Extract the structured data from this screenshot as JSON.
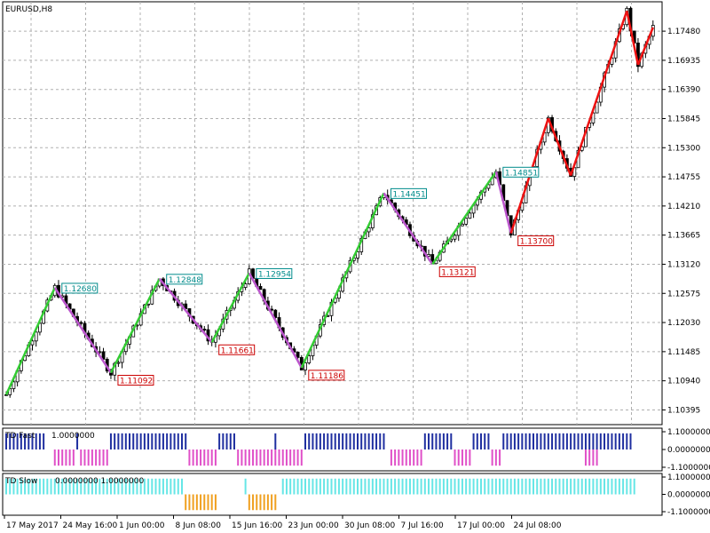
{
  "window_title": "EURUSD,H8",
  "colors": {
    "up_zigzag": "#33cc33",
    "down_zigzag": "#bb55cc",
    "recent_zigzag": "#ee1111",
    "high_label": "#008b8b",
    "low_label": "#cc0000",
    "fast_blue": "#1f2fa0",
    "fast_magenta": "#e050c8",
    "slow_cyan": "#66e6e6",
    "slow_orange": "#f0a020",
    "grid": "#b0b0b0"
  },
  "chart_data": [
    {
      "type": "candlestick",
      "title": "EURUSD,H8",
      "ylim": [
        1.1012,
        1.1803
      ],
      "y_ticks": [
        "1.17480",
        "1.16935",
        "1.16390",
        "1.15845",
        "1.15300",
        "1.14755",
        "1.14210",
        "1.13665",
        "1.13120",
        "1.12575",
        "1.12030",
        "1.11485",
        "1.10940",
        "1.10395"
      ],
      "x_ticks": [
        "17 May 2017",
        "24 May 16:00",
        "1 Jun 00:00",
        "8 Jun 08:00",
        "15 Jun 16:00",
        "23 Jun 00:00",
        "30 Jun 08:00",
        "7 Jul 16:00",
        "17 Jul 00:00",
        "24 Jul 08:00"
      ],
      "grid": true,
      "zigzag": [
        {
          "bar": 0,
          "price": 1.1068
        },
        {
          "bar": 13,
          "price": 1.1268,
          "label": "1.12680",
          "kind": "high"
        },
        {
          "bar": 28,
          "price": 1.11092,
          "label": "1.11092",
          "kind": "low"
        },
        {
          "bar": 41,
          "price": 1.12848,
          "label": "1.12848",
          "kind": "high"
        },
        {
          "bar": 55,
          "price": 1.11661,
          "label": "1.11661",
          "kind": "low"
        },
        {
          "bar": 65,
          "price": 1.12954,
          "label": "1.12954",
          "kind": "high"
        },
        {
          "bar": 79,
          "price": 1.11186,
          "label": "1.11186",
          "kind": "low"
        },
        {
          "bar": 101,
          "price": 1.14451,
          "label": "1.14451",
          "kind": "high"
        },
        {
          "bar": 114,
          "price": 1.13121,
          "label": "1.13121",
          "kind": "low"
        },
        {
          "bar": 131,
          "price": 1.14851,
          "label": "1.14851",
          "kind": "high"
        },
        {
          "bar": 135,
          "price": 1.137,
          "label": "1.13700",
          "kind": "low"
        },
        {
          "bar": 145,
          "price": 1.1585
        },
        {
          "bar": 151,
          "price": 1.1478
        },
        {
          "bar": 166,
          "price": 1.1786
        },
        {
          "bar": 169,
          "price": 1.1685
        },
        {
          "bar": 173,
          "price": 1.1755
        }
      ],
      "recent_zigzag_from_bar": 135
    },
    {
      "type": "histogram",
      "title": "TD Fast",
      "values_text": "1.0000000",
      "ylim": [
        -1.1,
        1.1
      ],
      "y_ticks": [
        "1.1000000",
        "0.0000000",
        "-1.1000000"
      ],
      "blue_up_ranges": [
        [
          0,
          10
        ],
        [
          19,
          19
        ],
        [
          28,
          48
        ],
        [
          57,
          61
        ],
        [
          72,
          72
        ],
        [
          80,
          101
        ],
        [
          112,
          119
        ],
        [
          125,
          129
        ],
        [
          133,
          160
        ],
        [
          161,
          167
        ]
      ],
      "magenta_down_ranges": [
        [
          13,
          18
        ],
        [
          20,
          27
        ],
        [
          49,
          56
        ],
        [
          62,
          79
        ],
        [
          103,
          111
        ],
        [
          120,
          124
        ],
        [
          130,
          132
        ],
        [
          155,
          158
        ]
      ]
    },
    {
      "type": "histogram",
      "title": "TD Slow",
      "values_text": "0.0000000 1.0000000",
      "ylim": [
        -1.1,
        1.1
      ],
      "y_ticks": [
        "1.1000000",
        "0.0000000",
        "-1.1000000"
      ],
      "cyan_up_ranges": [
        [
          0,
          47
        ],
        [
          64,
          64
        ],
        [
          74,
          168
        ]
      ],
      "orange_down_ranges": [
        [
          48,
          56
        ],
        [
          65,
          72
        ]
      ]
    }
  ]
}
